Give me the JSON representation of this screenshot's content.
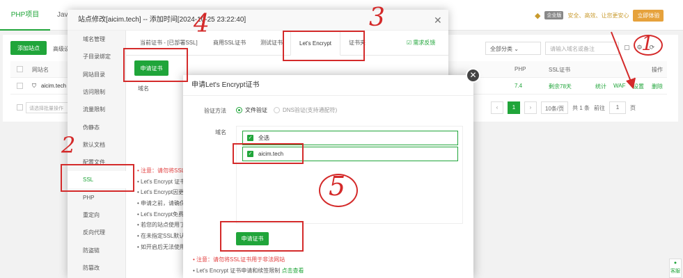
{
  "header": {
    "tab_php": "PHP项目",
    "tab_java": "Java",
    "pro_badge": "企业版",
    "slogan": "安全、高效、让您更安心",
    "try_button": "立即体验"
  },
  "toolbar": {
    "add_site": "添加站点",
    "advanced": "高级设",
    "category": "全部分类",
    "search_placeholder": "请输入域名或备注"
  },
  "table": {
    "col_domain": "网站名",
    "col_php": "PHP",
    "col_ssl": "SSL证书",
    "col_ops": "操作",
    "row": {
      "domain": "aicim.tech",
      "php": "7.4",
      "ssl_days": "剩余78天",
      "stats": "统计",
      "waf": "WAF",
      "settings": "设置",
      "delete": "删除"
    },
    "batch_placeholder": "请选择批量操作"
  },
  "pager": {
    "current": "1",
    "per_page": "10条/页",
    "total": "共 1 条",
    "goto_label": "前往",
    "goto_page": "1",
    "page_unit": "页"
  },
  "site_modal": {
    "title": "站点修改[aicim.tech] -- 添加时间[2024-10-25 23:22:40]",
    "nav": [
      "域名管理",
      "子目录绑定",
      "网站目录",
      "访问限制",
      "流量限制",
      "伪静态",
      "默认文档",
      "配置文件",
      "SSL",
      "PHP",
      "重定向",
      "反向代理",
      "防盗链",
      "防篡改"
    ],
    "tabs": {
      "current_cert": "当前证书 - [已部署SSL]",
      "commercial": "商用SSL证书",
      "test": "测试证书",
      "lets_encrypt": "Let's Encrypt",
      "cert_folder": "证书夹"
    },
    "feedback": "需求反馈",
    "apply_button": "申请证书",
    "domain_col": "域名",
    "notes": [
      "注意：请勿将SSL证书用于非法网站",
      "Let's Encrypt 证书申请和续签限制",
      "Let's Encrypt因更换根证书",
      "申请之前，请确保域名已解析",
      "Let's Encrypt免费证书有效期",
      "若您的站点使用了CDN",
      "在未指定SSL默认站点时",
      "如开启后无法使用HTTPS"
    ]
  },
  "le_dialog": {
    "title": "申请Let's Encrypt证书",
    "verify_label": "验证方法",
    "verify_file": "文件验证",
    "verify_dns": "DNS验证(支持通配符)",
    "domain_label": "域名",
    "select_all": "全选",
    "domain": "aicim.tech",
    "apply_button": "申请证书",
    "note_red": "注意：请勿将SSL证书用于非法网站",
    "note2": "Let's Encrypt 证书申请和续签限制",
    "note2_link": "点击查看"
  },
  "annotations": [
    "1",
    "2",
    "3",
    "4",
    "5"
  ],
  "float": {
    "label": "客服"
  }
}
